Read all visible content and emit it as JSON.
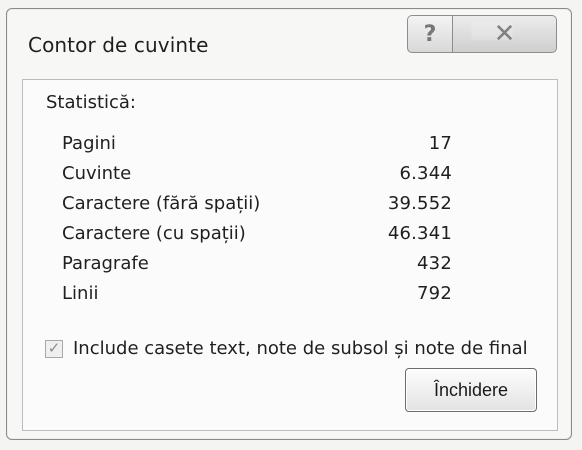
{
  "window": {
    "title": "Contor de cuvinte",
    "help_button": "?",
    "close_button": "✕"
  },
  "stats": {
    "section_label": "Statistică:",
    "items": [
      {
        "label": "Pagini",
        "value": "17"
      },
      {
        "label": "Cuvinte",
        "value": "6.344"
      },
      {
        "label": "Caractere (fără spații)",
        "value": "39.552"
      },
      {
        "label": "Caractere (cu spații)",
        "value": "46.341"
      },
      {
        "label": "Paragrafe",
        "value": "432"
      },
      {
        "label": "Linii",
        "value": "792"
      }
    ]
  },
  "options": {
    "include_label": "Include casete text, note de subsol și note de final",
    "include_checked": true,
    "check_mark": "✓"
  },
  "actions": {
    "close_label": "Închidere"
  }
}
